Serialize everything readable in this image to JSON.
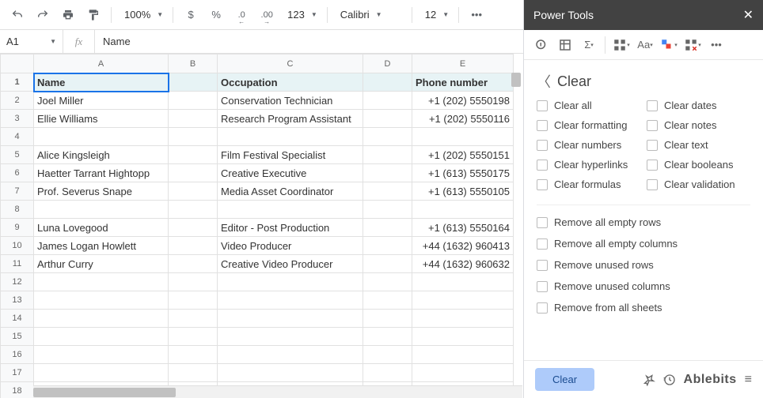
{
  "toolbar": {
    "zoom": "100%",
    "currency": "$",
    "percent": "%",
    "dec_dec": ".0",
    "dec_inc": ".00",
    "numfmt": "123",
    "font": "Calibri",
    "font_size": "12"
  },
  "namebox": {
    "ref": "A1",
    "formula": "Name"
  },
  "columns": [
    "A",
    "B",
    "C",
    "D",
    "E"
  ],
  "header_row": {
    "A": "Name",
    "C": "Occupation",
    "E": "Phone number"
  },
  "rows": [
    {
      "n": 2,
      "A": "Joel Miller",
      "C": "Conservation Technician",
      "E": "+1 (202) 5550198"
    },
    {
      "n": 3,
      "A": "Ellie Williams",
      "C": "Research Program Assistant",
      "E": "+1 (202) 5550116"
    },
    {
      "n": 4
    },
    {
      "n": 5,
      "A": "Alice Kingsleigh",
      "C": "Film Festival Specialist",
      "E": "+1 (202) 5550151"
    },
    {
      "n": 6,
      "A": "Haetter Tarrant Hightopp",
      "C": "Creative Executive",
      "E": "+1 (613) 5550175"
    },
    {
      "n": 7,
      "A": "Prof. Severus Snape",
      "C": "Media Asset Coordinator",
      "E": "+1 (613) 5550105"
    },
    {
      "n": 8
    },
    {
      "n": 9,
      "A": "Luna Lovegood",
      "C": "Editor - Post Production",
      "E": "+1 (613) 5550164"
    },
    {
      "n": 10,
      "A": "James Logan Howlett",
      "C": "Video Producer",
      "E": "+44 (1632) 960413"
    },
    {
      "n": 11,
      "A": "Arthur Curry",
      "C": "Creative Video Producer",
      "E": "+44 (1632) 960632"
    },
    {
      "n": 12
    },
    {
      "n": 13
    },
    {
      "n": 14
    },
    {
      "n": 15
    },
    {
      "n": 16
    },
    {
      "n": 17
    },
    {
      "n": 18
    }
  ],
  "sidebar": {
    "title": "Power Tools",
    "section": "Clear",
    "checks_left": [
      "Clear all",
      "Clear formatting",
      "Clear numbers",
      "Clear hyperlinks",
      "Clear formulas"
    ],
    "checks_right": [
      "Clear dates",
      "Clear notes",
      "Clear text",
      "Clear booleans",
      "Clear validation"
    ],
    "removes": [
      "Remove all empty rows",
      "Remove all empty columns",
      "Remove unused rows",
      "Remove unused columns",
      "Remove from all sheets"
    ],
    "button": "Clear",
    "brand": "Ablebits"
  }
}
